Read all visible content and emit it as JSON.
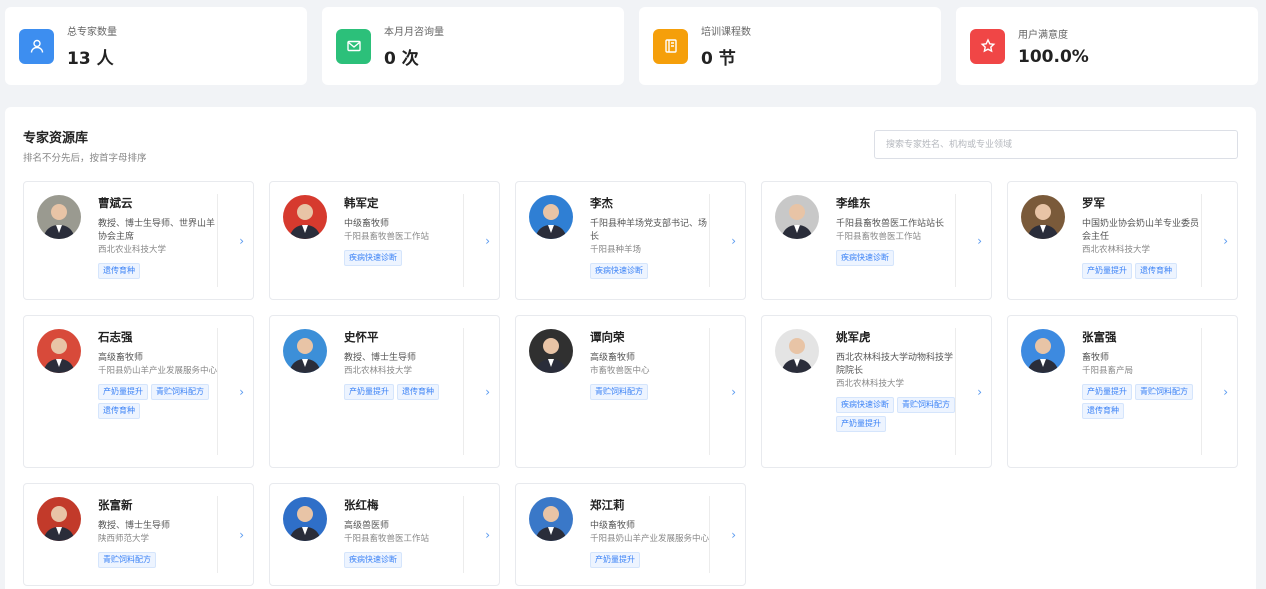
{
  "stats": [
    {
      "label": "总专家数量",
      "value": "13 人",
      "color": "#3d8ef0",
      "icon": "user-icon"
    },
    {
      "label": "本月月咨询量",
      "value": "0 次",
      "color": "#2cc07a",
      "icon": "mail-icon"
    },
    {
      "label": "培训课程数",
      "value": "0 节",
      "color": "#f59f0a",
      "icon": "book-icon"
    },
    {
      "label": "用户满意度",
      "value": "100.0%",
      "color": "#f04646",
      "icon": "star-icon"
    }
  ],
  "panel": {
    "title": "专家资源库",
    "subtitle": "排名不分先后，按首字母排序",
    "search_placeholder": "搜索专家姓名、机构或专业领域"
  },
  "experts": [
    {
      "name": "曹斌云",
      "title": "教授、博士生导师、世界山羊协会主席",
      "org": "西北农业科技大学",
      "tags": [
        "遗传育种"
      ]
    },
    {
      "name": "韩军定",
      "title": "中级畜牧师",
      "org": "千阳县畜牧兽医工作站",
      "tags": [
        "疾病快速诊断"
      ]
    },
    {
      "name": "李杰",
      "title": "千阳县种羊场党支部书记、场长",
      "org": "千阳县种羊场",
      "tags": [
        "疾病快速诊断"
      ]
    },
    {
      "name": "李维东",
      "title": "千阳县畜牧兽医工作站站长",
      "org": "千阳县畜牧兽医工作站",
      "tags": [
        "疾病快速诊断"
      ]
    },
    {
      "name": "罗军",
      "title": "中国奶业协会奶山羊专业委员会主任",
      "org": "西北农林科技大学",
      "tags": [
        "产奶量提升",
        "遗传育种"
      ]
    },
    {
      "name": "石志强",
      "title": "高级畜牧师",
      "org": "千阳县奶山羊产业发展服务中心",
      "tags": [
        "产奶量提升",
        "青贮饲料配方",
        "遗传育种"
      ]
    },
    {
      "name": "史怀平",
      "title": "教授、博士生导师",
      "org": "西北农林科技大学",
      "tags": [
        "产奶量提升",
        "遗传育种"
      ]
    },
    {
      "name": "谭向荣",
      "title": "高级畜牧师",
      "org": "市畜牧兽医中心",
      "tags": [
        "青贮饲料配方"
      ]
    },
    {
      "name": "姚军虎",
      "title": "西北农林科技大学动物科技学院院长",
      "org": "西北农林科技大学",
      "tags": [
        "疾病快速诊断",
        "青贮饲料配方",
        "产奶量提升"
      ]
    },
    {
      "name": "张富强",
      "title": "畜牧师",
      "org": "千阳县畜产局",
      "tags": [
        "产奶量提升",
        "青贮饲料配方",
        "遗传育种"
      ]
    },
    {
      "name": "张富新",
      "title": "教授、博士生导师",
      "org": "陕西师范大学",
      "tags": [
        "青贮饲料配方"
      ]
    },
    {
      "name": "张红梅",
      "title": "高级兽医师",
      "org": "千阳县畜牧兽医工作站",
      "tags": [
        "疾病快速诊断"
      ]
    },
    {
      "name": "郑江莉",
      "title": "中级畜牧师",
      "org": "千阳县奶山羊产业发展服务中心",
      "tags": [
        "产奶量提升"
      ]
    }
  ],
  "arrow_glyph": "›"
}
